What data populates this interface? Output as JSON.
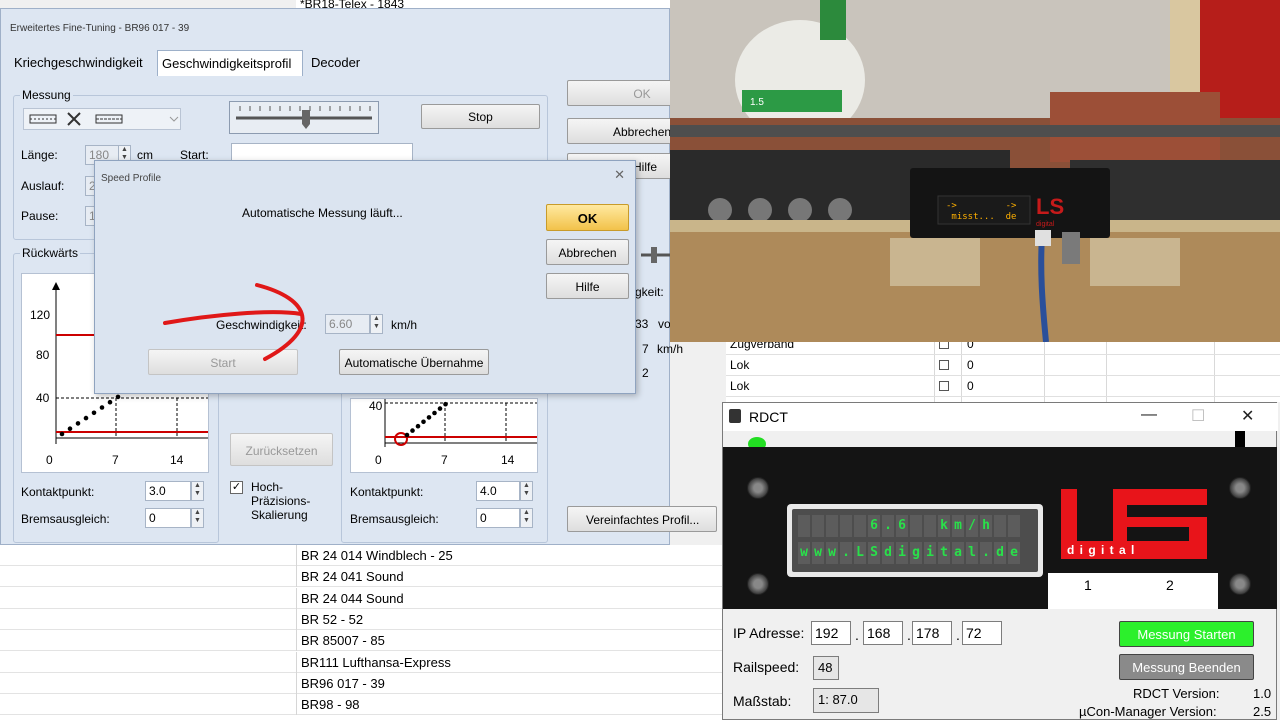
{
  "background": {
    "top_item": "*BR18-Telex - 1843",
    "loco_list": [
      "BR 24 014 Windblech - 25",
      "BR 24 041 Sound",
      "BR 24 044 Sound",
      "BR 52 - 52",
      "BR 85007 - 85",
      "BR111 Lufthansa-Express",
      "BR96 017 - 39",
      "BR98 - 98"
    ],
    "right_table": [
      {
        "name": "Zugverband",
        "value": "0"
      },
      {
        "name": "Lok",
        "value": "0"
      },
      {
        "name": "Lok",
        "value": "0"
      }
    ]
  },
  "fine_tuning": {
    "title": "Erweitertes Fine-Tuning - BR96 017 - 39",
    "tabs": [
      "Kriechgeschwindigkeit",
      "Geschwindigkeitsprofil",
      "Decoder"
    ],
    "measurement_group": "Messung",
    "laenge_label": "Länge:",
    "laenge_value": "180",
    "laenge_unit": "cm",
    "start_label": "Start:",
    "auslauf_label": "Auslauf:",
    "auslauf_value": "2",
    "pause_label": "Pause:",
    "pause_value": "1",
    "stop_button": "Stop",
    "ok_button": "OK",
    "abbrechen_button": "Abbrechen",
    "hilfe_button": "Hilfe",
    "rueckwaerts_group": "Rückwärts",
    "left_chart": {
      "y_ticks": [
        "120",
        "80",
        "40"
      ],
      "x_ticks": [
        "0",
        "7",
        "14"
      ]
    },
    "right_chart": {
      "y_ticks": [
        "40"
      ],
      "x_ticks": [
        "0",
        "7",
        "14"
      ]
    },
    "kontaktpunkt_label": "Kontaktpunkt:",
    "kontaktpunkt_left": "3.0",
    "kontaktpunkt_right": "4.0",
    "bremsausgleich_label": "Bremsausgleich:",
    "bremsausgleich_left": "0",
    "bremsausgleich_right": "0",
    "zuruecksetzen_button": "Zurücksetzen",
    "hochpraezision_label": "Hoch-\nPräzisions-\nSkalierung",
    "hochpraezision_checked": "✓",
    "vereinfachtes_button": "Vereinfachtes Profil...",
    "geschwindigkeit_partial": "gkeit:",
    "partial_33": "33",
    "partial_vo": "vo",
    "partial_7": "7",
    "partial_kmh": "km/h",
    "partial_2": "2"
  },
  "speed_profile": {
    "title": "Speed Profile",
    "close": "✕",
    "status": "Automatische Messung läuft...",
    "geschwindigkeit_label": "Geschwindigkeit:",
    "geschwindigkeit_value": "6.60",
    "unit": "km/h",
    "start_button": "Start",
    "uebernahme_button": "Automatische Übernahme",
    "ok_button": "OK",
    "abbrechen_button": "Abbrechen",
    "hilfe_button": "Hilfe"
  },
  "camera": {
    "device_display_line1": "->         ->",
    "device_display_line2": " misst...  de",
    "device_logo": "LS",
    "device_logo_sub": "digital",
    "bottle_label": "1.5"
  },
  "rdct": {
    "title": "RDCT",
    "minimize": "—",
    "maximize": "☐",
    "close": "✕",
    "lcd_line1": "          6.6    km/h    ",
    "lcd_line2": "www.LSdigital.de",
    "logo_text": "LS",
    "logo_sub": "d i g i t a l",
    "port_1": "1",
    "port_2": "2",
    "ip_label": "IP Adresse:",
    "ip": [
      "192",
      "168",
      "178",
      "72"
    ],
    "railspeed_label": "Railspeed:",
    "railspeed_value": "48",
    "massstab_label": "Maßstab:",
    "massstab_value": "1: 87.0",
    "start_button": "Messung Starten",
    "stop_button": "Messung Beenden",
    "rdct_version_label": "RDCT Version:",
    "rdct_version": "1.0",
    "ucon_version_label": "µCon-Manager Version:",
    "ucon_version": "2.5",
    "colors": {
      "start_green": "#2cf02c",
      "logo_red": "#e8141a",
      "lcd_green": "#29e04a"
    }
  }
}
